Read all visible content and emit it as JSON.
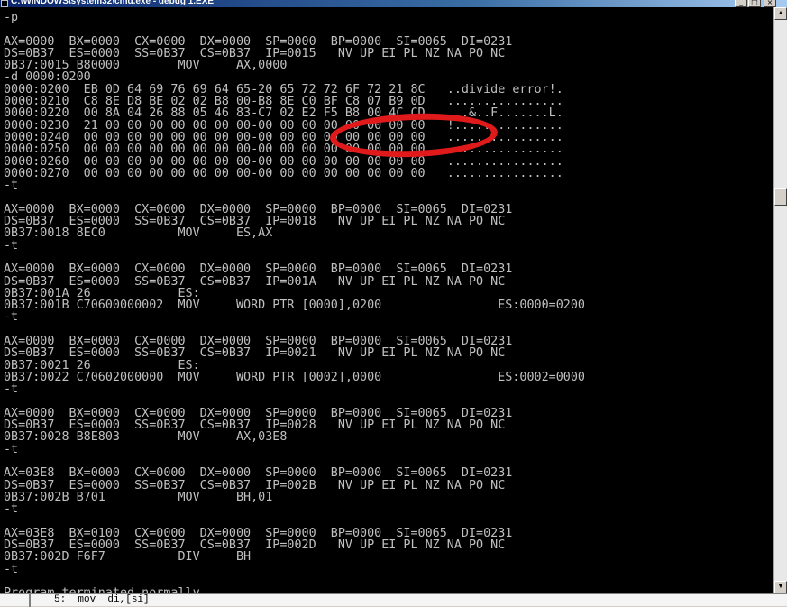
{
  "window": {
    "title": "C:\\WINDOWS\\system32\\cmd.exe - debug 1.EXE",
    "minimize_glyph": "_",
    "maximize_glyph": "□",
    "close_glyph": "×"
  },
  "console": {
    "lines": [
      "-p",
      "",
      "AX=0000  BX=0000  CX=0000  DX=0000  SP=0000  BP=0000  SI=0065  DI=0231",
      "DS=0B37  ES=0000  SS=0B37  CS=0B37  IP=0015   NV UP EI PL NZ NA PO NC",
      "0B37:0015 B80000        MOV     AX,0000",
      "-d 0000:0200",
      "0000:0200  EB 0D 64 69 76 69 64 65-20 65 72 72 6F 72 21 8C   ..divide error!.",
      "0000:0210  C8 8E D8 BE 02 02 B8 00-B8 8E C0 BF C8 07 B9 0D   ................",
      "0000:0220  00 8A 04 26 88 05 46 83-C7 02 E2 F5 B8 00 4C CD   ...&..F.......L.",
      "0000:0230  21 00 00 00 00 00 00 00-00 00 00 00 00 00 00 00   !...............",
      "0000:0240  00 00 00 00 00 00 00 00-00 00 00 00 00 00 00 00   ................",
      "0000:0250  00 00 00 00 00 00 00 00-00 00 00 00 00 00 00 00   ................",
      "0000:0260  00 00 00 00 00 00 00 00-00 00 00 00 00 00 00 00   ................",
      "0000:0270  00 00 00 00 00 00 00 00-00 00 00 00 00 00 00 00   ................",
      "-t",
      "",
      "AX=0000  BX=0000  CX=0000  DX=0000  SP=0000  BP=0000  SI=0065  DI=0231",
      "DS=0B37  ES=0000  SS=0B37  CS=0B37  IP=0018   NV UP EI PL NZ NA PO NC",
      "0B37:0018 8EC0          MOV     ES,AX",
      "-t",
      "",
      "AX=0000  BX=0000  CX=0000  DX=0000  SP=0000  BP=0000  SI=0065  DI=0231",
      "DS=0B37  ES=0000  SS=0B37  CS=0B37  IP=001A   NV UP EI PL NZ NA PO NC",
      "0B37:001A 26            ES:",
      "0B37:001B C70600000002  MOV     WORD PTR [0000],0200                ES:0000=0200",
      "-t",
      "",
      "AX=0000  BX=0000  CX=0000  DX=0000  SP=0000  BP=0000  SI=0065  DI=0231",
      "DS=0B37  ES=0000  SS=0B37  CS=0B37  IP=0021   NV UP EI PL NZ NA PO NC",
      "0B37:0021 26            ES:",
      "0B37:0022 C70602000000  MOV     WORD PTR [0002],0000                ES:0002=0000",
      "-t",
      "",
      "AX=0000  BX=0000  CX=0000  DX=0000  SP=0000  BP=0000  SI=0065  DI=0231",
      "DS=0B37  ES=0000  SS=0B37  CS=0B37  IP=0028   NV UP EI PL NZ NA PO NC",
      "0B37:0028 B8E803        MOV     AX,03E8",
      "-t",
      "",
      "AX=03E8  BX=0000  CX=0000  DX=0000  SP=0000  BP=0000  SI=0065  DI=0231",
      "DS=0B37  ES=0000  SS=0B37  CS=0B37  IP=002B   NV UP EI PL NZ NA PO NC",
      "0B37:002B B701          MOV     BH,01",
      "-t",
      "",
      "AX=03E8  BX=0100  CX=0000  DX=0000  SP=0000  BP=0000  SI=0065  DI=0231",
      "DS=0B37  ES=0000  SS=0B37  CS=0B37  IP=002D   NV UP EI PL NZ NA PO NC",
      "0B37:002D F6F7          DIV     BH",
      "-t",
      "",
      "Program terminated normally",
      "-"
    ]
  },
  "annotation": {
    "color": "#e01a1a"
  },
  "scrollbar": {
    "up_glyph": "▲",
    "down_glyph": "▼"
  },
  "bottom_strip": {
    "text": "5:  mov  di,[si]"
  }
}
